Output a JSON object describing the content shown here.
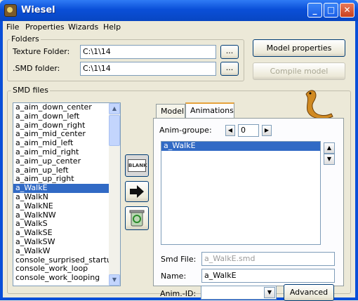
{
  "window": {
    "title": "Wiesel"
  },
  "menu": [
    {
      "label": "File"
    },
    {
      "label": "Properties"
    },
    {
      "label": "Wizards"
    },
    {
      "label": "Help"
    }
  ],
  "folders": {
    "group_label": "Folders",
    "texture_label": "Texture Folder:",
    "texture_value": "C:\\1\\14",
    "smd_label": ".SMD folder:",
    "smd_value": "C:\\1\\14",
    "browse_label": "..."
  },
  "buttons": {
    "model_properties": "Model properties",
    "compile_model": "Compile model",
    "advanced": "Advanced"
  },
  "smd_files": {
    "group_label": "SMD files",
    "items": [
      "a_aim_down_center",
      "a_aim_down_left",
      "a_aim_down_right",
      "a_aim_mid_center",
      "a_aim_mid_left",
      "a_aim_mid_right",
      "a_aim_up_center",
      "a_aim_up_left",
      "a_aim_up_right",
      "a_WalkE",
      "a_WalkN",
      "a_WalkNE",
      "a_WalkNW",
      "a_WalkS",
      "a_WalkSE",
      "a_WalkSW",
      "a_WalkW",
      "console_surprised_startup",
      "console_work_loop",
      "console_work_looping"
    ],
    "selected": "a_WalkE"
  },
  "tool_buttons": {
    "blank_label": "BLANK",
    "blank_icon": "blank-icon",
    "arrow_icon": "right-arrow-icon",
    "recycle_icon": "recycle-bin-icon"
  },
  "tabs": [
    {
      "label": "Model"
    },
    {
      "label": "Animations"
    }
  ],
  "animations": {
    "group_label": "Anim-groupe:",
    "group_value": "0",
    "list_items": [
      "a_WalkE"
    ],
    "smd_file_label": "Smd File:",
    "smd_file_value": "a_WalkE.smd",
    "name_label": "Name:",
    "name_value": "a_WalkE",
    "anim_id_label": "Anim.-ID:",
    "anim_id_value": ""
  },
  "mascot_icon": "weasel-icon"
}
